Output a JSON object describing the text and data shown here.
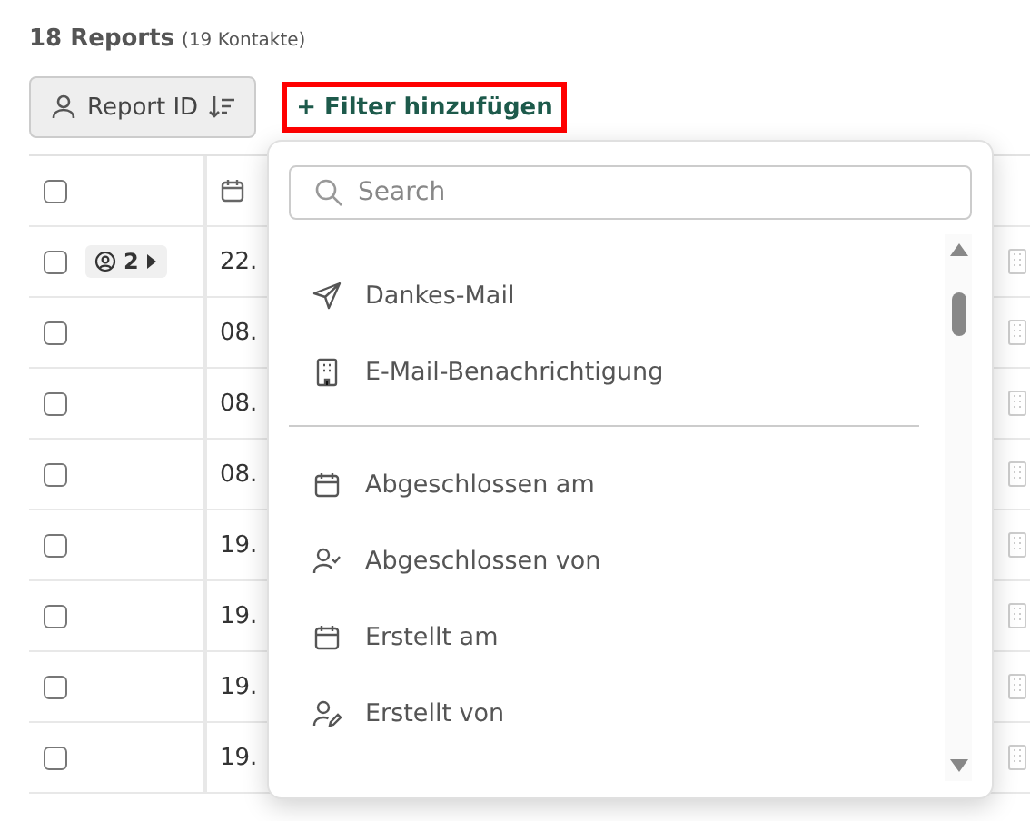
{
  "header": {
    "title": "18 Reports",
    "subtitle": "(19 Kontakte)"
  },
  "toolbar": {
    "sort_button": "Report ID",
    "filter_button": "+ Filter hinzufügen"
  },
  "table": {
    "rows": [
      {
        "checked": false,
        "badge": "2",
        "date": "22."
      },
      {
        "checked": false,
        "date": "08."
      },
      {
        "checked": false,
        "date": "08."
      },
      {
        "checked": false,
        "date": "08."
      },
      {
        "checked": false,
        "date": "19."
      },
      {
        "checked": false,
        "date": "19."
      },
      {
        "checked": false,
        "date": "19."
      },
      {
        "checked": false,
        "date": "19."
      }
    ],
    "header_checked": false
  },
  "dropdown": {
    "search": {
      "placeholder": "Search"
    },
    "groups": [
      [
        {
          "kind": "send",
          "label": "Dankes-Mail"
        },
        {
          "kind": "building",
          "label": "E-Mail-Benachrichtigung"
        }
      ],
      [
        {
          "kind": "calendar",
          "label": "Abgeschlossen am"
        },
        {
          "kind": "user-check",
          "label": "Abgeschlossen von"
        },
        {
          "kind": "calendar",
          "label": "Erstellt am"
        },
        {
          "kind": "user-edit",
          "label": "Erstellt von"
        }
      ]
    ]
  }
}
